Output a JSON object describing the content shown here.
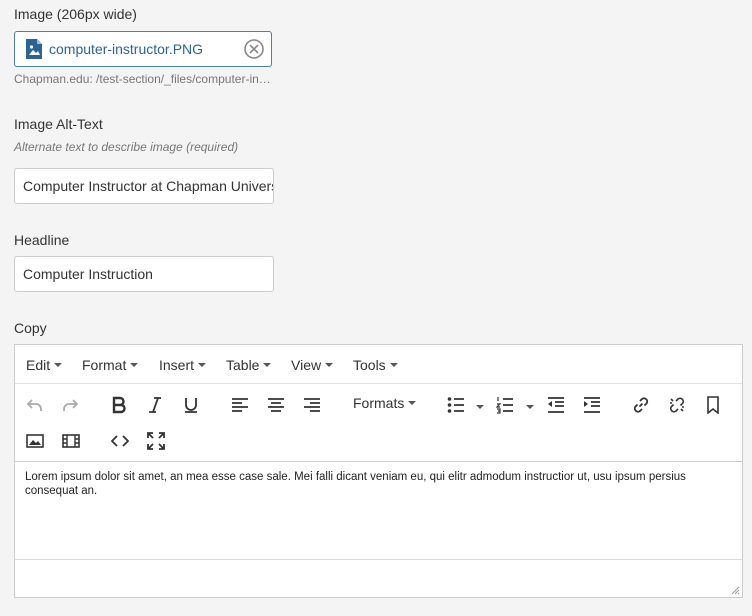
{
  "image_field": {
    "label": "Image (206px wide)",
    "filename": "computer-instructor.PNG",
    "path": "Chapman.edu: /test-section/_files/computer-instructor.PNG"
  },
  "alt_text": {
    "label": "Image Alt-Text",
    "hint": "Alternate text to describe image (required)",
    "value": "Computer Instructor at Chapman University"
  },
  "headline": {
    "label": "Headline",
    "value": "Computer Instruction"
  },
  "copy": {
    "label": "Copy",
    "menus": [
      "Edit",
      "Format",
      "Insert",
      "Table",
      "View",
      "Tools"
    ],
    "formats_label": "Formats",
    "body": "Lorem ipsum dolor sit amet, an mea esse case sale. Mei falli dicant veniam eu, qui elitr admodum instructior ut, usu ipsum persius consequat an."
  },
  "colors": {
    "accent": "#4b7fa6",
    "link": "#2a6496"
  }
}
